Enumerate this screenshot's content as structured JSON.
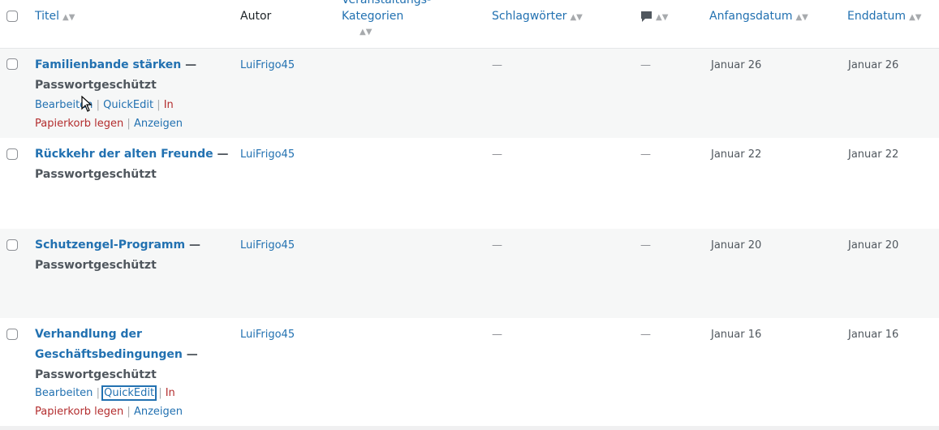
{
  "header": {
    "title": "Titel",
    "author": "Autor",
    "category_line1": "Veranstaltungs-",
    "category_line2": "Kategorien",
    "tags": "Schlagwörter",
    "comments_icon": "comment-bubble-icon",
    "start_date": "Anfangsdatum",
    "end_date": "Enddatum",
    "sort_glyph": "▲▼"
  },
  "rows": [
    {
      "title": "Familienbande stärken",
      "suffix": " —",
      "status": "Passwortgeschützt",
      "author": "LuiFrigo45",
      "tags": "—",
      "comments": "—",
      "start": "Januar 26",
      "end": "Januar 26",
      "actions": {
        "edit": "Bearbeiten",
        "quick": "QuickEdit",
        "trash1": "In",
        "trash2": "Papierkorb legen",
        "view": "Anzeigen",
        "sep": "|"
      }
    },
    {
      "title": "Rückkehr der alten Freunde",
      "suffix": " —",
      "status": "Passwortgeschützt",
      "author": "LuiFrigo45",
      "tags": "—",
      "comments": "—",
      "start": "Januar 22",
      "end": "Januar 22"
    },
    {
      "title": "Schutzengel-Programm",
      "suffix": " —",
      "status": "Passwortgeschützt",
      "author": "LuiFrigo45",
      "tags": "—",
      "comments": "—",
      "start": "Januar 20",
      "end": "Januar 20"
    },
    {
      "title_line1": "Verhandlung der",
      "title_line2": "Geschäftsbedingungen",
      "suffix": " —",
      "status": "Passwortgeschützt",
      "author": "LuiFrigo45",
      "tags": "—",
      "comments": "—",
      "start": "Januar 16",
      "end": "Januar 16",
      "actions": {
        "edit": "Bearbeiten",
        "quick": "QuickEdit",
        "trash1": "In",
        "trash2": "Papierkorb legen",
        "view": "Anzeigen",
        "sep": "|"
      }
    }
  ],
  "colors": {
    "link": "#2271b1",
    "trash": "#b32d2e",
    "alt_row": "#f6f7f7"
  }
}
